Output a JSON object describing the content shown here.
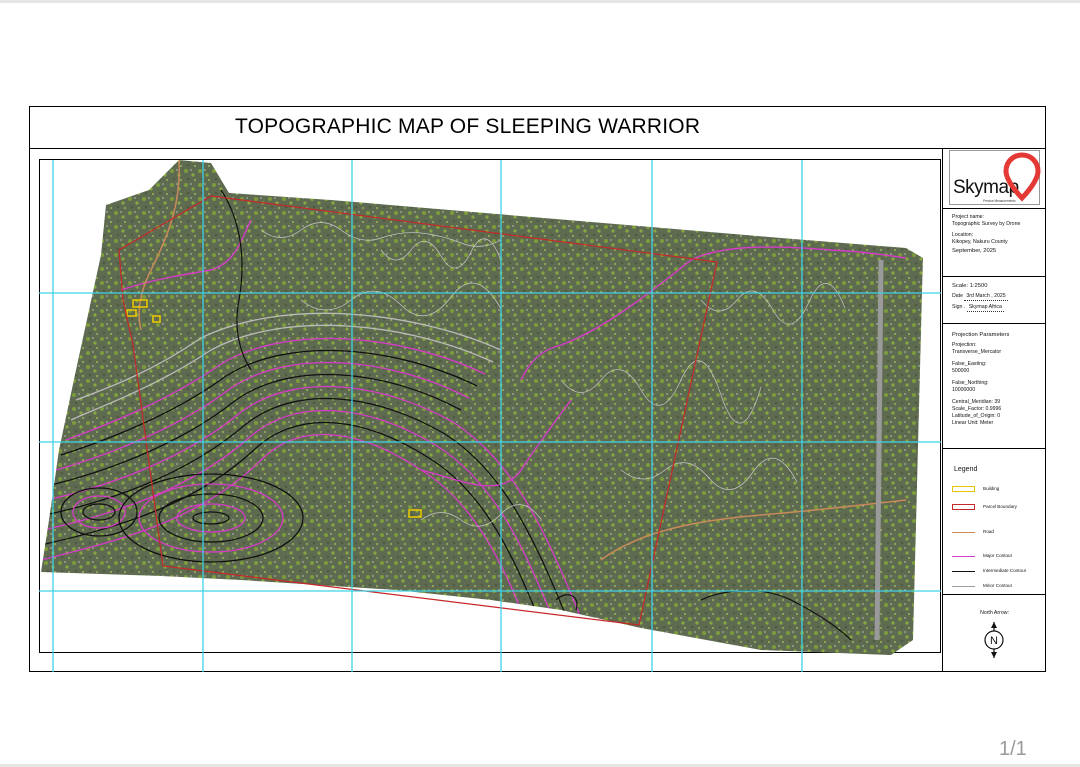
{
  "title": "TOPOGRAPHIC MAP OF SLEEPING WARRIOR",
  "logo": {
    "brand": "Skymap",
    "tagline": "Precise Measurements",
    "accent_color": "#e53935"
  },
  "project": {
    "name_label": "Project name:",
    "name": "Topographic Survey by Drone",
    "location_label": "Location:",
    "location": "Kikopey, Nakuru County",
    "date_text": "September, 2025"
  },
  "scale_block": {
    "scale": "Scale: 1:2500",
    "date_label": "Date",
    "date": "3rd March , 2025",
    "sign_label": "Sign",
    "sign": "Skymap Africa"
  },
  "projection": {
    "heading": "Projection Parameters",
    "projection_label": "Projection:",
    "projection": "Transverse_Mercator",
    "false_easting_label": "False_Easting:",
    "false_easting": "500000",
    "false_northing_label": "False_Northing:",
    "false_northing": "10000000",
    "central_meridian": "Central_Meridian: 39",
    "scale_factor": "Scale_Factor: 0.9996",
    "latitude_of_origin": "Latitude_of_Origin: 0",
    "linear_unit": "Linear Unit: Meter"
  },
  "legend": {
    "title": "Legend",
    "items": [
      {
        "label": "Building",
        "color": "#e6c600",
        "kind": "box"
      },
      {
        "label": "Parcel Boundary",
        "color": "#c62828",
        "kind": "box"
      },
      {
        "label": "Road",
        "color": "#c98a5a",
        "kind": "line"
      },
      {
        "label": "Major Contour",
        "color": "#d63cc8",
        "kind": "line"
      },
      {
        "label": "Intermediate Contour",
        "color": "#111111",
        "kind": "line"
      },
      {
        "label": "Minor Contour",
        "color": "#9e9e9e",
        "kind": "line"
      }
    ]
  },
  "north_arrow": {
    "label": "North Arrow:",
    "letter": "N"
  },
  "colors": {
    "grid": "#3fd3e6",
    "terrain": "#5e6a52",
    "vegetation": "#7fa23a"
  },
  "page_number": "1/1"
}
